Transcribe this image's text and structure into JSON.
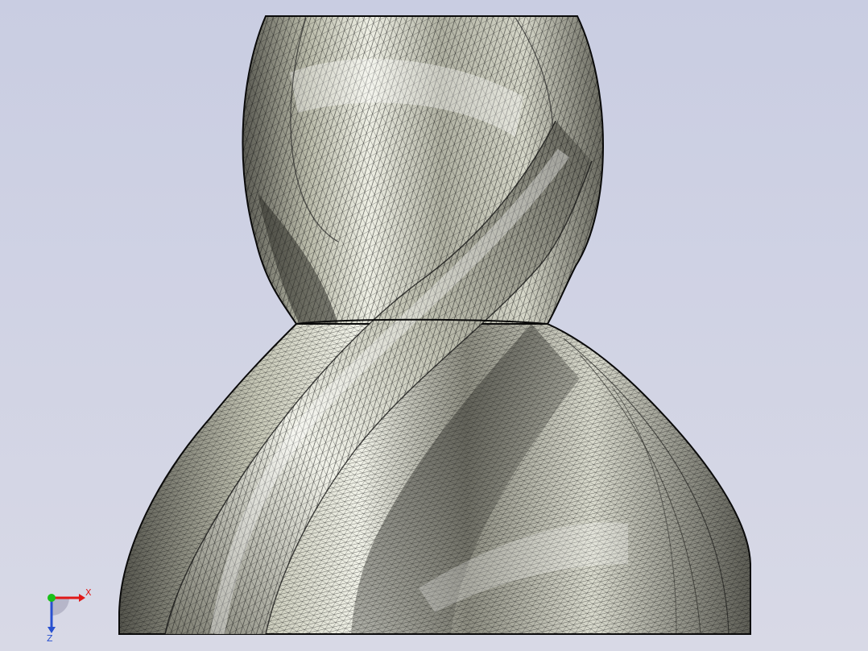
{
  "viewport": {
    "background_top": "#c9cde2",
    "background_bottom": "#d8d9e6"
  },
  "model": {
    "shape": "twisted-vase",
    "surface_light": "#e6e7dc",
    "surface_mid": "#a7a79a",
    "surface_dark": "#3a3a34",
    "mesh_color": "#111111",
    "outline_color": "#0a0a0a"
  },
  "triad": {
    "x_label": "X",
    "y_label": "",
    "z_label": "Z",
    "x_color": "#e01818",
    "y_color": "#19c019",
    "z_color": "#2850d0"
  }
}
